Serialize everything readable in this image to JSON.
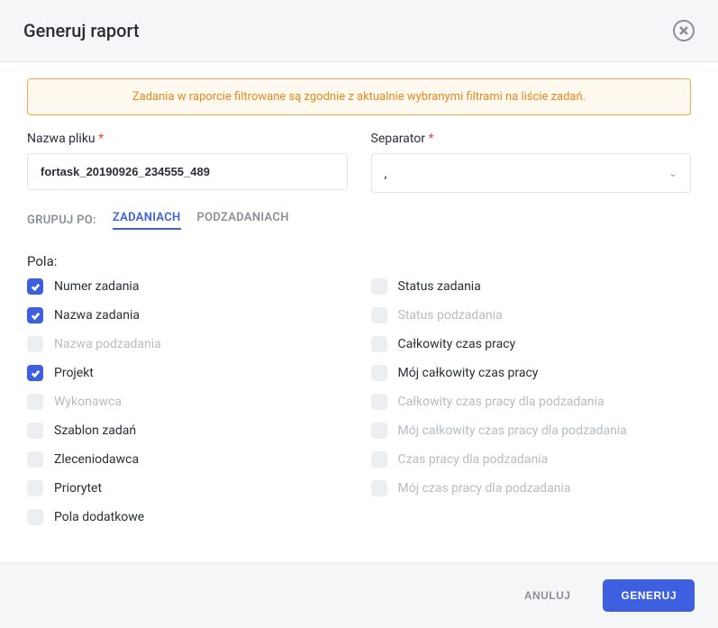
{
  "header": {
    "title": "Generuj raport"
  },
  "alert": "Zadania w raporcie filtrowane są zgodnie z aktualnie wybranymi filtrami na liście zadań.",
  "filename": {
    "label": "Nazwa pliku",
    "value": "fortask_20190926_234555_489"
  },
  "separator": {
    "label": "Separator",
    "value": ","
  },
  "grouping": {
    "label": "Grupuj po:",
    "tabs": {
      "tasks": "Zadaniach",
      "subtasks": "Podzadaniach"
    }
  },
  "fields": {
    "label": "Pola:",
    "left": [
      {
        "label": "Numer zadania",
        "checked": true,
        "disabled": false
      },
      {
        "label": "Nazwa zadania",
        "checked": true,
        "disabled": false
      },
      {
        "label": "Nazwa podzadania",
        "checked": false,
        "disabled": true
      },
      {
        "label": "Projekt",
        "checked": true,
        "disabled": false
      },
      {
        "label": "Wykonawca",
        "checked": false,
        "disabled": true
      },
      {
        "label": "Szablon zadań",
        "checked": false,
        "disabled": false
      },
      {
        "label": "Zleceniodawca",
        "checked": false,
        "disabled": false
      },
      {
        "label": "Priorytet",
        "checked": false,
        "disabled": false
      },
      {
        "label": "Pola dodatkowe",
        "checked": false,
        "disabled": false
      }
    ],
    "right": [
      {
        "label": "Status zadania",
        "checked": false,
        "disabled": false
      },
      {
        "label": "Status podzadania",
        "checked": false,
        "disabled": true
      },
      {
        "label": "Całkowity czas pracy",
        "checked": false,
        "disabled": false
      },
      {
        "label": "Mój całkowity czas pracy",
        "checked": false,
        "disabled": false
      },
      {
        "label": "Całkowity czas pracy dla podzadania",
        "checked": false,
        "disabled": true
      },
      {
        "label": "Mój całkowity czas pracy dla podzadania",
        "checked": false,
        "disabled": true
      },
      {
        "label": "Czas pracy dla podzadania",
        "checked": false,
        "disabled": true
      },
      {
        "label": "Mój czas pracy dla podzadania",
        "checked": false,
        "disabled": true
      }
    ]
  },
  "footer": {
    "cancel": "Anuluj",
    "generate": "Generuj"
  }
}
